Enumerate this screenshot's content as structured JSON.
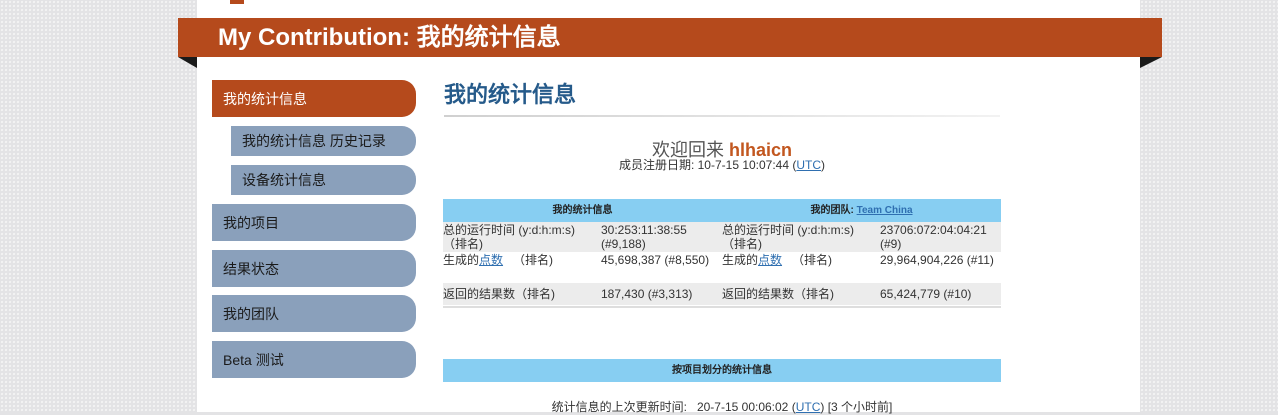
{
  "banner": {
    "title": "My Contribution:  我的统计信息"
  },
  "nav": {
    "items": [
      {
        "label": "我的统计信息"
      },
      {
        "label": "我的统计信息 历史记录"
      },
      {
        "label": "设备统计信息"
      },
      {
        "label": "我的项目"
      },
      {
        "label": "结果状态"
      },
      {
        "label": "我的团队"
      },
      {
        "label": "Beta 测试"
      }
    ]
  },
  "main": {
    "title": "我的统计信息",
    "welcome_prefix": "欢迎回来",
    "username": "hlhaicn",
    "reg_label": "成员注册日期:",
    "reg_date": "10-7-15 10:07:44 (",
    "utc": "UTC",
    "reg_close": ")"
  },
  "my_stats": {
    "header": "我的统计信息",
    "runtime_label": "总的运行时间 (y:d:h:m:s) （排名)",
    "runtime_value": "30:253:11:38:55 (#9,188)",
    "points_prefix": "生成的",
    "points_link": "点数",
    "points_suffix": "（排名)",
    "points_value": "45,698,387 (#8,550)",
    "results_label": "返回的结果数（排名)",
    "results_value": "187,430 (#3,313)"
  },
  "team_stats": {
    "header_prefix": "我的团队: ",
    "team_link": "Team China",
    "runtime_label": "总的运行时间 (y:d:h:m:s) （排名)",
    "runtime_value": "23706:072:04:04:21 (#9)",
    "points_prefix": "生成的",
    "points_link": "点数",
    "points_suffix": "（排名)",
    "points_value": "29,964,904,226 (#11)",
    "results_label": "返回的结果数（排名)",
    "results_value": "65,424,779 (#10)"
  },
  "projects": {
    "header": "按项目划分的统计信息"
  },
  "footer": {
    "label": "统计信息的上次更新时间:",
    "time": "20-7-15 00:06:02 (",
    "utc": "UTC",
    "ago": ") [3 个小时前]"
  }
}
